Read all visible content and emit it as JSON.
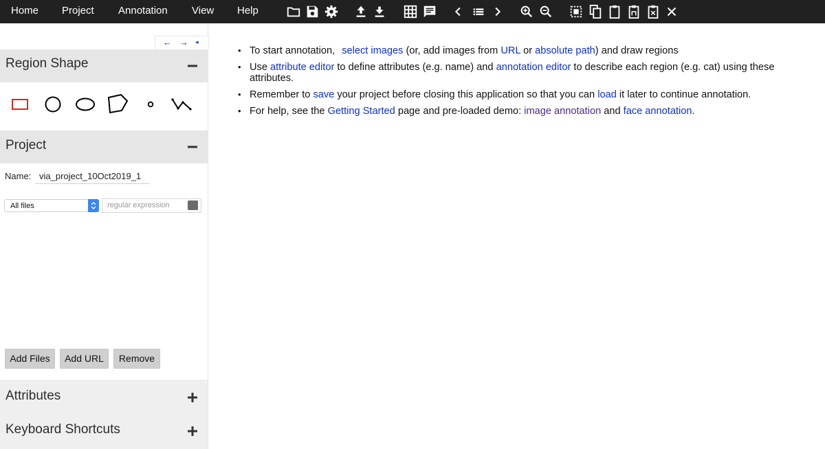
{
  "menu": [
    "Home",
    "Project",
    "Annotation",
    "View",
    "Help"
  ],
  "toolbar_icons": [
    "folder-open-icon",
    "save-icon",
    "settings-icon",
    "upload-icon",
    "download-icon",
    "grid-view-icon",
    "comment-icon",
    "chevron-left-icon",
    "list-icon",
    "chevron-right-icon",
    "zoom-in-icon",
    "zoom-out-icon",
    "select-all-icon",
    "copy-icon",
    "paste-icon",
    "paste-special-icon",
    "paste-delete-icon",
    "close-icon"
  ],
  "panel_arrows": {
    "left": "←",
    "right": "→",
    "small": "◂"
  },
  "region_shape": {
    "title": "Region Shape",
    "toggle": "−"
  },
  "shapes": [
    "rectangle",
    "circle",
    "ellipse",
    "polygon",
    "point",
    "polyline"
  ],
  "project": {
    "title": "Project",
    "toggle": "−",
    "name_label": "Name:",
    "name_value": "via_project_10Oct2019_1",
    "filter_selected": "All files",
    "regex_placeholder": "regular expression",
    "buttons": {
      "add_files": "Add Files",
      "add_url": "Add URL",
      "remove": "Remove"
    }
  },
  "attributes": {
    "title": "Attributes",
    "toggle": "+"
  },
  "shortcuts": {
    "title": "Keyboard Shortcuts",
    "toggle": "+"
  },
  "colors": {
    "topbar": "#212121",
    "link": "#0b2fd6",
    "visited_link": "#4a2a8a",
    "rect_shape": "#d9291c",
    "section_bg": "#e6e6e6"
  },
  "content": {
    "l1": {
      "a": "To start annotation,",
      "b": "select images",
      "c": "(or, add images from",
      "d": "URL",
      "e": "or",
      "f": "absolute path",
      "g": ") and draw regions"
    },
    "l2": {
      "a": "Use",
      "b": "attribute editor",
      "c": "to define attributes (e.g. name) and",
      "d": "annotation editor",
      "e": "to describe each region (e.g. cat) using these attributes."
    },
    "l3": {
      "a": "Remember to",
      "b": "save",
      "c": "your project before closing this application so that you can",
      "d": "load",
      "e": "it later to continue annotation."
    },
    "l4": {
      "a": "For help, see the",
      "b": "Getting Started",
      "c": "page and pre-loaded demo:",
      "d": "image annotation",
      "e": "and",
      "f": "face annotation",
      "g": "."
    }
  }
}
